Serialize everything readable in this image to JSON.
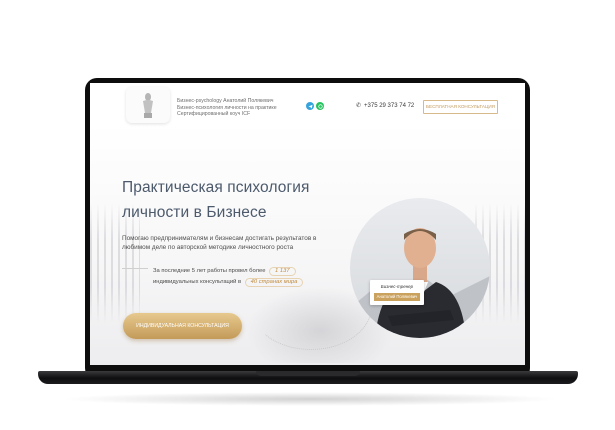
{
  "header": {
    "tagline": [
      "Бизнес-psychology Анатолий Полякевич",
      "Бизнес-психология личности на практике",
      "Сертифицированный коуч ICF"
    ],
    "phone": "+375 29 373 74 72",
    "cta_label": "БЕСПЛАТНАЯ КОНСУЛЬТАЦИЯ"
  },
  "hero": {
    "headline": [
      "Практическая психология",
      "личности в Бизнесе"
    ],
    "description": [
      "Помогаю предпринимателям и бизнесам достигать результатов в",
      "любимом деле по авторской методике личностного роста"
    ],
    "stat_prefix": "За последние 5 лет работы провел более",
    "stat_count": "1 137",
    "stat_mid": "индивидуальных консультаций в",
    "stat_countries": "40 странах мира",
    "button_label": "ИНДИВИДУАЛЬНАЯ КОНСУЛЬТАЦИЯ"
  },
  "person": {
    "role": "Бизнес-тренер",
    "name": "Анатолий Полякевич"
  },
  "icons": [
    "logo-figure-icon",
    "telegram-icon",
    "whatsapp-icon",
    "phone-icon"
  ],
  "colors": {
    "accent_gold": "#c49b5e",
    "headline": "#4c5a6c",
    "telegram": "#36a4dc",
    "whatsapp": "#27c35f"
  }
}
